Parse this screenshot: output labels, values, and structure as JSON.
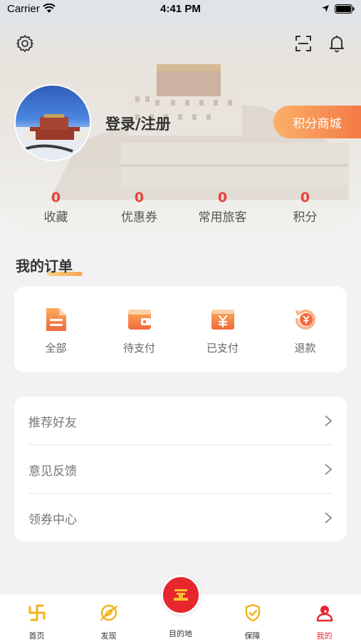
{
  "status_bar": {
    "carrier": "Carrier",
    "time": "4:41 PM"
  },
  "header": {
    "login_label": "登录/注册",
    "mall_button": "积分商城",
    "stats": [
      {
        "value": "0",
        "label": "收藏"
      },
      {
        "value": "0",
        "label": "优惠券"
      },
      {
        "value": "0",
        "label": "常用旅客"
      },
      {
        "value": "0",
        "label": "积分"
      }
    ]
  },
  "orders": {
    "title": "我的订单",
    "items": [
      {
        "label": "全部",
        "icon": "document-icon"
      },
      {
        "label": "待支付",
        "icon": "wallet-icon"
      },
      {
        "label": "已支付",
        "icon": "yuan-bill-icon"
      },
      {
        "label": "退款",
        "icon": "refund-icon"
      }
    ]
  },
  "menu": {
    "items": [
      {
        "label": "推荐好友"
      },
      {
        "label": "意见反馈"
      },
      {
        "label": "领券中心"
      }
    ]
  },
  "tabbar": {
    "items": [
      {
        "label": "首页",
        "icon": "home-swastika-icon"
      },
      {
        "label": "发现",
        "icon": "discover-icon"
      },
      {
        "label": "目的地",
        "icon": "destination-icon"
      },
      {
        "label": "保障",
        "icon": "shield-check-icon"
      },
      {
        "label": "我的",
        "icon": "user-icon"
      }
    ],
    "active": "我的"
  },
  "colors": {
    "accent": "#e8413b",
    "orange": "#f47a45",
    "tab_gold": "#f2b21a",
    "tab_red": "#e8262e"
  }
}
